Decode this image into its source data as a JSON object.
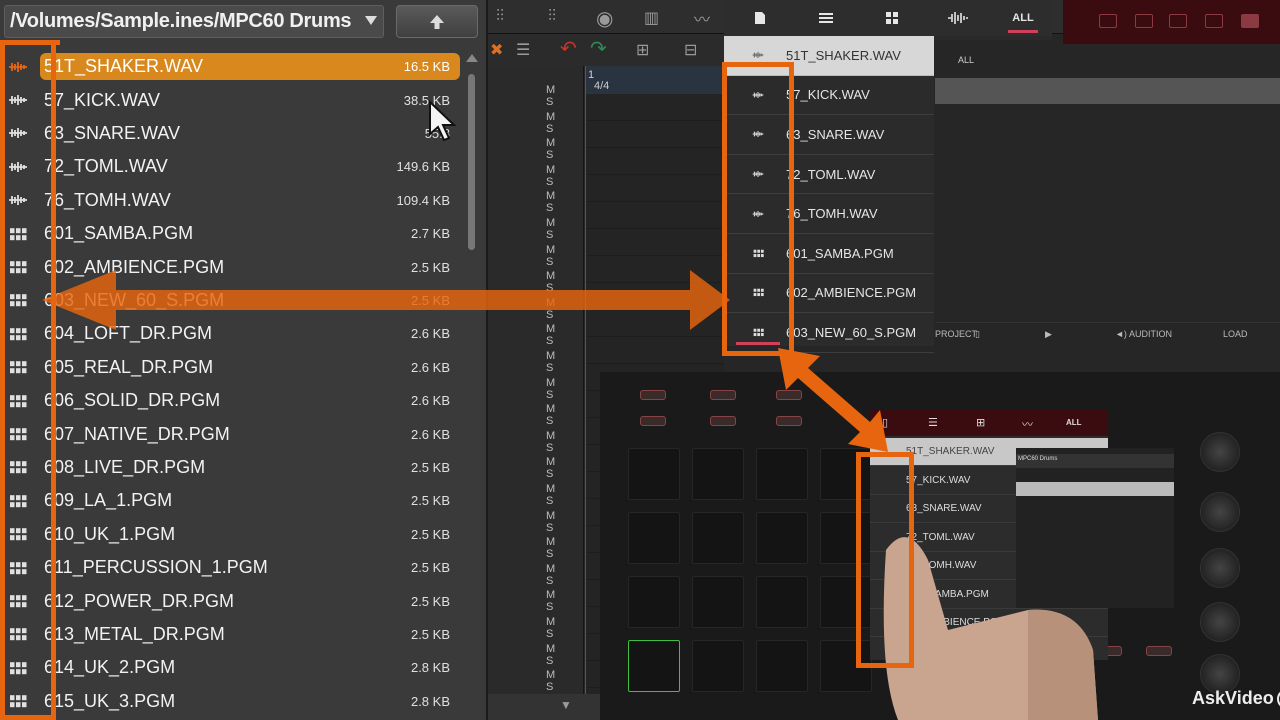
{
  "browser": {
    "path": "/Volumes/Sample.ines/MPC60 Drums",
    "up_icon": "up-arrow-icon",
    "files": [
      {
        "name": "51T_SHAKER.WAV",
        "size": "16.5 KB",
        "type": "sample",
        "selected": true
      },
      {
        "name": "57_KICK.WAV",
        "size": "38.5 KB",
        "type": "sample"
      },
      {
        "name": "63_SNARE.WAV",
        "size": "55.8",
        "type": "sample"
      },
      {
        "name": "72_TOML.WAV",
        "size": "149.6 KB",
        "type": "sample"
      },
      {
        "name": "76_TOMH.WAV",
        "size": "109.4 KB",
        "type": "sample"
      },
      {
        "name": "601_SAMBA.PGM",
        "size": "2.7 KB",
        "type": "program"
      },
      {
        "name": "602_AMBIENCE.PGM",
        "size": "2.5 KB",
        "type": "program"
      },
      {
        "name": "603_NEW_60_S.PGM",
        "size": "2.5 KB",
        "type": "program"
      },
      {
        "name": "604_LOFT_DR.PGM",
        "size": "2.6 KB",
        "type": "program"
      },
      {
        "name": "605_REAL_DR.PGM",
        "size": "2.6 KB",
        "type": "program"
      },
      {
        "name": "606_SOLID_DR.PGM",
        "size": "2.6 KB",
        "type": "program"
      },
      {
        "name": "607_NATIVE_DR.PGM",
        "size": "2.6 KB",
        "type": "program"
      },
      {
        "name": "608_LIVE_DR.PGM",
        "size": "2.5 KB",
        "type": "program"
      },
      {
        "name": "609_LA_1.PGM",
        "size": "2.5 KB",
        "type": "program"
      },
      {
        "name": "610_UK_1.PGM",
        "size": "2.5 KB",
        "type": "program"
      },
      {
        "name": "611_PERCUSSION_1.PGM",
        "size": "2.5 KB",
        "type": "program"
      },
      {
        "name": "612_POWER_DR.PGM",
        "size": "2.5 KB",
        "type": "program"
      },
      {
        "name": "613_METAL_DR.PGM",
        "size": "2.5 KB",
        "type": "program"
      },
      {
        "name": "614_UK_2.PGM",
        "size": "2.8 KB",
        "type": "program"
      },
      {
        "name": "615_UK_3.PGM",
        "size": "2.8 KB",
        "type": "program"
      }
    ]
  },
  "sequencer": {
    "bar_number": "1",
    "time_signature": "4/4",
    "track_ms_label": "M S",
    "all_label": "ALL",
    "lower_buttons": {
      "project": "PROJECT",
      "audition": "AUDITION",
      "load": "LOAD"
    }
  },
  "touch_browser": {
    "tabs": [
      {
        "icon": "file-icon"
      },
      {
        "icon": "sliders-icon"
      },
      {
        "icon": "program-grid-icon"
      },
      {
        "icon": "waveform-icon"
      },
      {
        "label": "ALL"
      }
    ],
    "items": [
      {
        "name": "51T_SHAKER.WAV",
        "type": "sample"
      },
      {
        "name": "57_KICK.WAV",
        "type": "sample"
      },
      {
        "name": "63_SNARE.WAV",
        "type": "sample"
      },
      {
        "name": "72_TOML.WAV",
        "type": "sample"
      },
      {
        "name": "76_TOMH.WAV",
        "type": "sample"
      },
      {
        "name": "601_SAMBA.PGM",
        "type": "program"
      },
      {
        "name": "602_AMBIENCE.PGM",
        "type": "program"
      },
      {
        "name": "603_NEW_60_S.PGM",
        "type": "program"
      }
    ]
  },
  "hardware_screen": {
    "tabs": [
      "ALL"
    ],
    "items": [
      "51T_SHAKER.WAV",
      "57_KICK.WAV",
      "63_SNARE.WAV",
      "72_TOML.WAV",
      "76_TOMH.WAV",
      "601_SAMBA.PGM",
      "602_AMBIENCE.PGM"
    ],
    "right_title": "MPC60 Drums"
  },
  "watermark": {
    "text": "AskVideo"
  },
  "colors": {
    "accent_orange": "#e8650f",
    "selection_orange": "#d8881c",
    "brand_pink": "#d0405a"
  }
}
